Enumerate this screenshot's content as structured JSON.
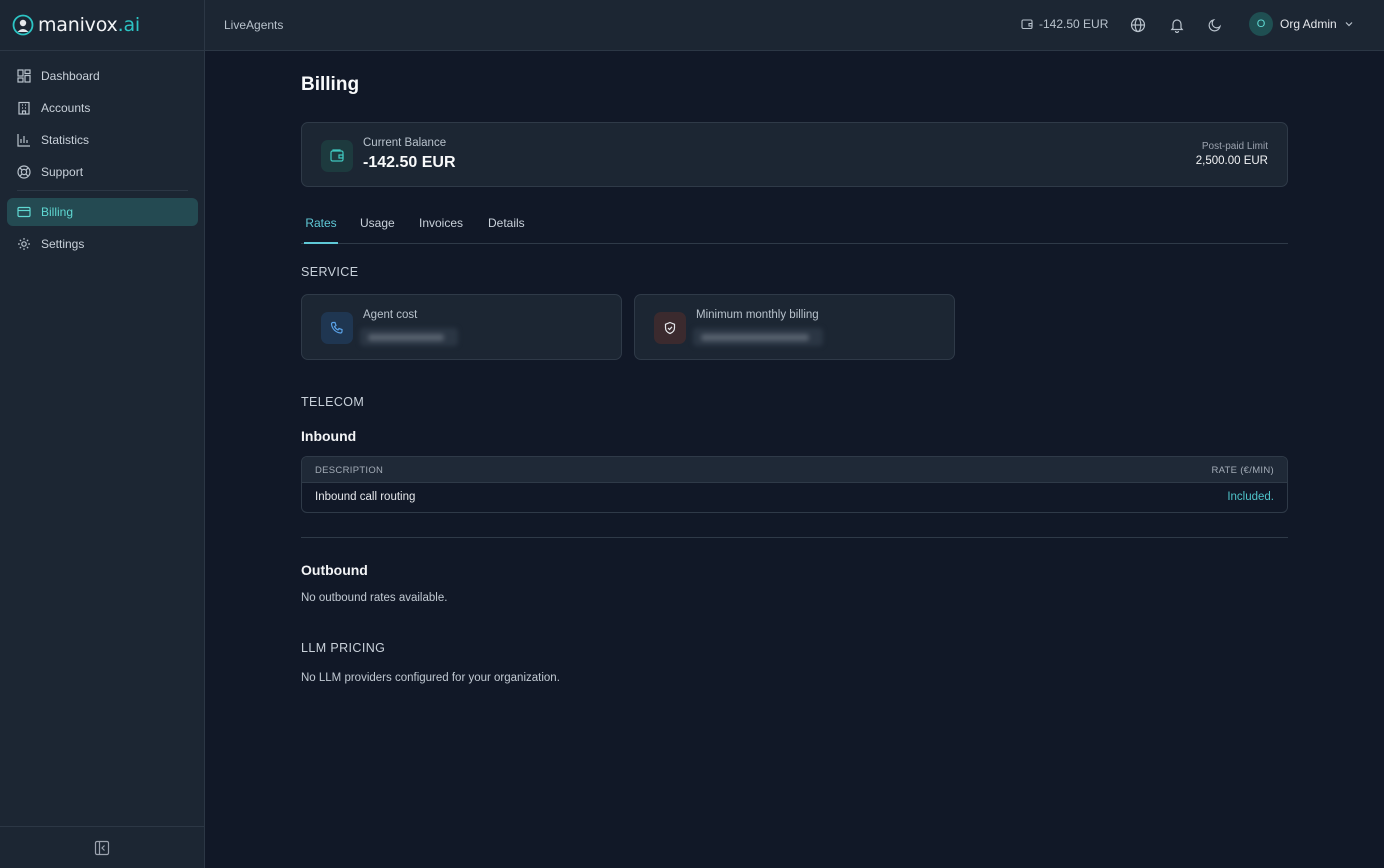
{
  "brand": {
    "name": "manivox",
    "suffix": ".ai",
    "accent": "#2cc4c4"
  },
  "sidebar": {
    "items": [
      {
        "label": "Dashboard",
        "icon": "dashboard-icon",
        "active": false
      },
      {
        "label": "Accounts",
        "icon": "building-icon",
        "active": false
      },
      {
        "label": "Statistics",
        "icon": "bar-chart-icon",
        "active": false
      },
      {
        "label": "Support",
        "icon": "lifebuoy-icon",
        "active": false
      },
      {
        "label": "Billing",
        "icon": "credit-card-icon",
        "active": true
      },
      {
        "label": "Settings",
        "icon": "gear-icon",
        "active": false
      }
    ]
  },
  "topbar": {
    "title": "LiveAgents",
    "balance": "-142.50 EUR",
    "user": {
      "initial": "O",
      "name": "Org Admin"
    }
  },
  "page": {
    "title": "Billing"
  },
  "balance_card": {
    "label": "Current Balance",
    "value": "-142.50 EUR",
    "limit_label": "Post-paid Limit",
    "limit_value": "2,500.00 EUR"
  },
  "tabs": [
    {
      "label": "Rates",
      "active": true
    },
    {
      "label": "Usage",
      "active": false
    },
    {
      "label": "Invoices",
      "active": false
    },
    {
      "label": "Details",
      "active": false
    }
  ],
  "service": {
    "heading": "SERVICE",
    "cards": [
      {
        "label": "Agent cost",
        "icon": "phone-icon"
      },
      {
        "label": "Minimum monthly billing",
        "icon": "shield-check-icon"
      }
    ]
  },
  "telecom": {
    "heading": "TELECOM",
    "inbound": {
      "title": "Inbound",
      "columns": {
        "description": "DESCRIPTION",
        "rate": "RATE (€/MIN)"
      },
      "rows": [
        {
          "description": "Inbound call routing",
          "rate": "Included."
        }
      ]
    },
    "outbound": {
      "title": "Outbound",
      "empty": "No outbound rates available."
    }
  },
  "llm": {
    "heading": "LLM PRICING",
    "empty": "No LLM providers configured for your organization."
  }
}
